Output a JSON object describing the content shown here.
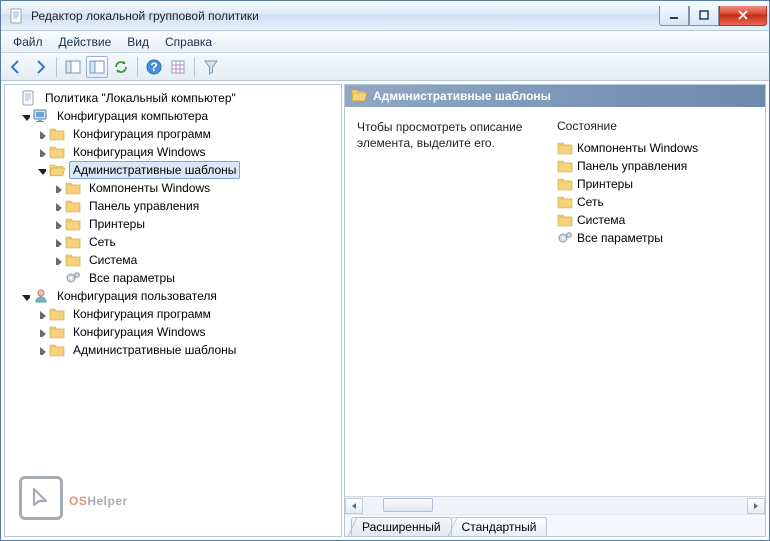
{
  "window": {
    "title": "Редактор локальной групповой политики"
  },
  "menu": {
    "file": "Файл",
    "action": "Действие",
    "view": "Вид",
    "help": "Справка"
  },
  "tree": {
    "root": "Политика \"Локальный компьютер\"",
    "comp": "Конфигурация компьютера",
    "comp_children": {
      "progs": "Конфигурация программ",
      "win": "Конфигурация Windows",
      "admin": "Административные шаблоны",
      "admin_children": {
        "wincomp": "Компоненты Windows",
        "panel": "Панель управления",
        "printers": "Принтеры",
        "net": "Сеть",
        "system": "Система",
        "all": "Все параметры"
      }
    },
    "user": "Конфигурация пользователя",
    "user_children": {
      "progs": "Конфигурация программ",
      "win": "Конфигурация Windows",
      "admin": "Административные шаблоны"
    }
  },
  "right": {
    "header": "Административные шаблоны",
    "desc": "Чтобы просмотреть описание элемента, выделите его.",
    "state_hdr": "Состояние",
    "items": {
      "wincomp": "Компоненты Windows",
      "panel": "Панель управления",
      "printers": "Принтеры",
      "net": "Сеть",
      "system": "Система",
      "all": "Все параметры"
    }
  },
  "tabs": {
    "extended": "Расширенный",
    "standard": "Стандартный"
  },
  "watermark": {
    "os": "OS",
    "helper": "Helper"
  }
}
